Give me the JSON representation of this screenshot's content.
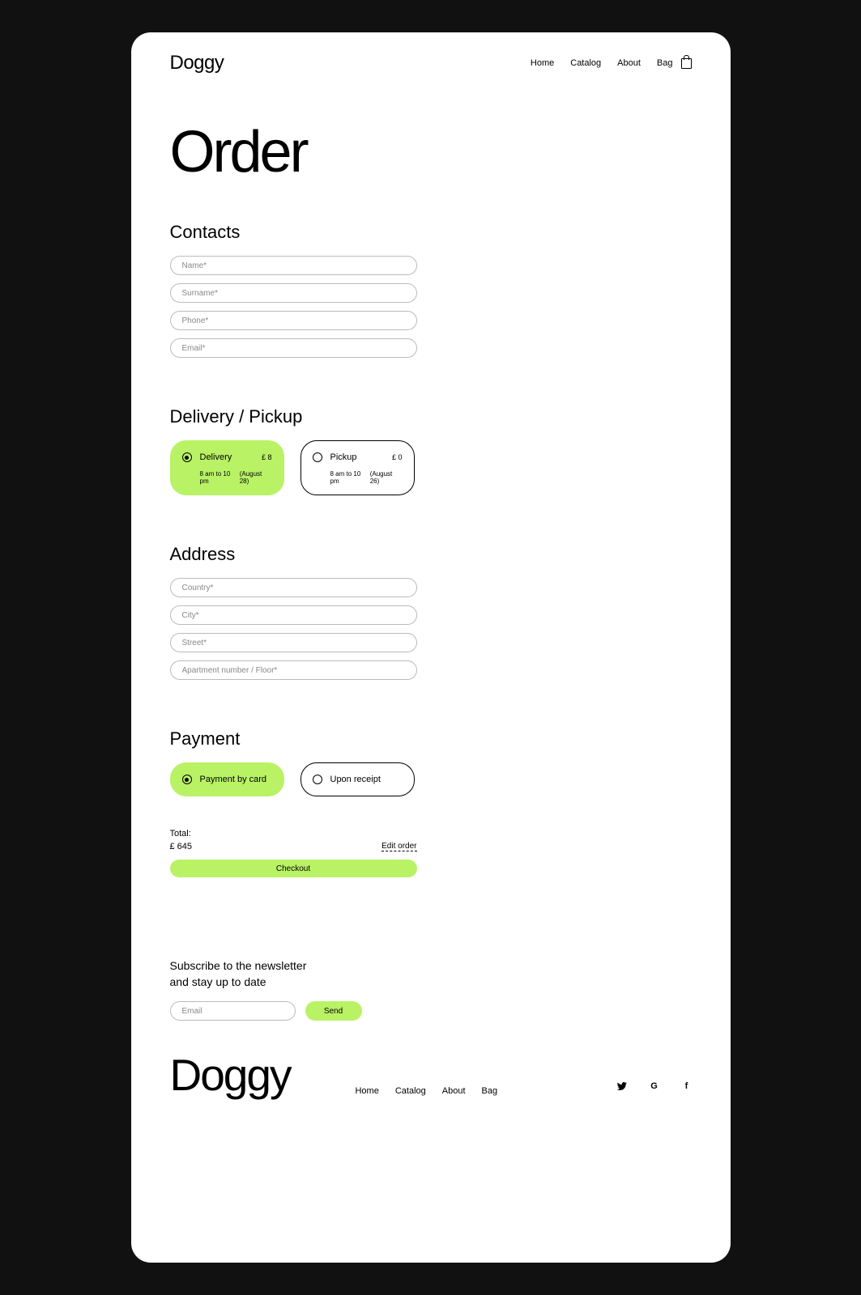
{
  "brand": "Doggy",
  "nav": {
    "home": "Home",
    "catalog": "Catalog",
    "about": "About",
    "bag": "Bag"
  },
  "pageTitle": "Order",
  "contacts": {
    "title": "Contacts",
    "name_ph": "Name*",
    "surname_ph": "Surname*",
    "phone_ph": "Phone*",
    "email_ph": "Email*"
  },
  "delivery": {
    "title": "Delivery / Pickup",
    "options": [
      {
        "label": "Delivery",
        "price": "£ 8",
        "hours": "8 am to 10 pm",
        "date": "(August 28)",
        "selected": true
      },
      {
        "label": "Pickup",
        "price": "£ 0",
        "hours": "8 am to 10 pm",
        "date": "(August 26)",
        "selected": false
      }
    ]
  },
  "address": {
    "title": "Address",
    "country_ph": "Country*",
    "city_ph": "City*",
    "street_ph": "Street*",
    "apt_ph": "Apartment number / Floor*"
  },
  "payment": {
    "title": "Payment",
    "options": [
      {
        "label": "Payment by card",
        "selected": true
      },
      {
        "label": "Upon receipt",
        "selected": false
      }
    ]
  },
  "total": {
    "label": "Total:",
    "amount": "£ 645",
    "edit": "Edit order",
    "checkout": "Checkout"
  },
  "newsletter": {
    "line1": "Subscribe to the newsletter",
    "line2": "and stay up to date",
    "email_ph": "Email",
    "send": "Send"
  },
  "footer": {
    "logo": "Doggy",
    "nav": {
      "home": "Home",
      "catalog": "Catalog",
      "about": "About",
      "bag": "Bag"
    }
  }
}
